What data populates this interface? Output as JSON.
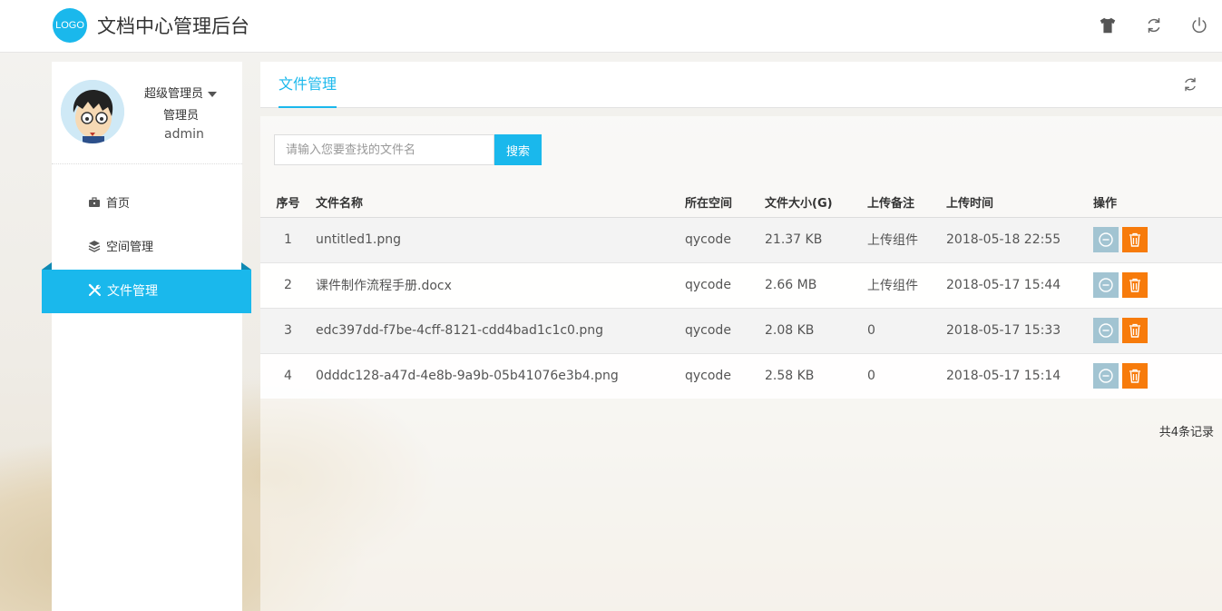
{
  "header": {
    "logo_text": "LOGO",
    "title": "文档中心管理后台",
    "icons": [
      "theme-shirt-icon",
      "refresh-icon",
      "power-icon"
    ]
  },
  "user": {
    "role": "超级管理员",
    "role_sub": "管理员",
    "username": "admin"
  },
  "sidebar": {
    "items": [
      {
        "label": "首页",
        "icon": "briefcase-icon"
      },
      {
        "label": "空间管理",
        "icon": "layers-icon"
      },
      {
        "label": "文件管理",
        "icon": "tools-icon",
        "active": true
      }
    ]
  },
  "tabs": {
    "active_label": "文件管理"
  },
  "search": {
    "placeholder": "请输入您要查找的文件名",
    "button_label": "搜索"
  },
  "table": {
    "columns": [
      "序号",
      "文件名称",
      "所在空间",
      "文件大小(G)",
      "上传备注",
      "上传时间",
      "操作"
    ],
    "rows": [
      {
        "no": "1",
        "name": "untitled1.png",
        "space": "qycode",
        "size": "21.37 KB",
        "remark": "上传组件",
        "time": "2018-05-18 22:55"
      },
      {
        "no": "2",
        "name": "课件制作流程手册.docx",
        "space": "qycode",
        "size": "2.66 MB",
        "remark": "上传组件",
        "time": "2018-05-17 15:44"
      },
      {
        "no": "3",
        "name": "edc397dd-f7be-4cff-8121-cdd4bad1c1c0.png",
        "space": "qycode",
        "size": "2.08 KB",
        "remark": "0",
        "time": "2018-05-17 15:33"
      },
      {
        "no": "4",
        "name": "0dddc128-a47d-4e8b-9a9b-05b41076e3b4.png",
        "space": "qycode",
        "size": "2.58 KB",
        "remark": "0",
        "time": "2018-05-17 15:14"
      }
    ]
  },
  "pagination": {
    "total_text": "共4条记录"
  },
  "colors": {
    "accent": "#1ab8ec",
    "disable_button": "#a2c4d2",
    "delete_button": "#f77b0b"
  }
}
